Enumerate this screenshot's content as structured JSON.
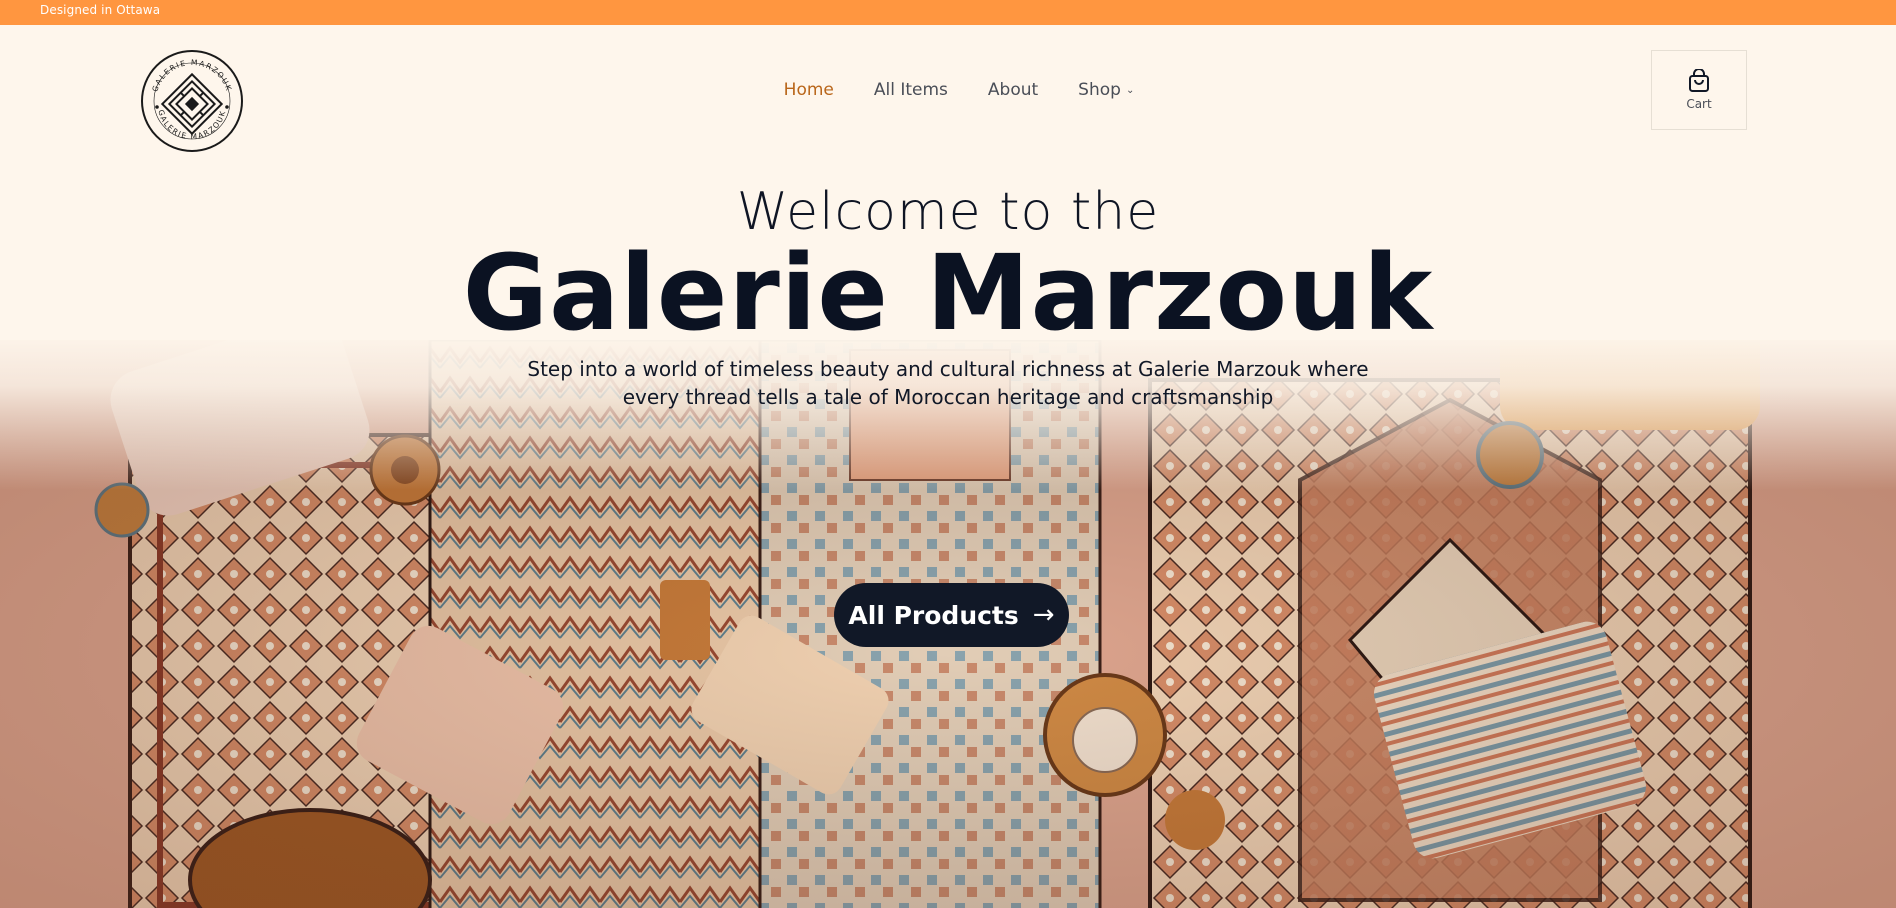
{
  "topbar": {
    "text": "Designed in Ottawa"
  },
  "logo": {
    "alt": "GALERIE MARZOUK",
    "ring_text": "GALERIE MARZOUK"
  },
  "nav": {
    "items": [
      {
        "label": "Home",
        "active": true
      },
      {
        "label": "All Items",
        "active": false
      },
      {
        "label": "About",
        "active": false
      },
      {
        "label": "Shop",
        "active": false,
        "dropdown": true
      }
    ]
  },
  "cart": {
    "label": "Cart",
    "icon": "shopping-bag-icon"
  },
  "hero": {
    "welcome": "Welcome to the",
    "title": "Galerie Marzouk",
    "tagline_line1": "Step into a world of timeless beauty and cultural richness at Galerie Marzouk where",
    "tagline_line2": "every thread tells a tale of Moroccan heritage and craftsmanship",
    "cta_label": "All Products",
    "cta_icon": "arrow-right-icon"
  },
  "colors": {
    "topbar": "#ff9640",
    "background": "#fef6ec",
    "active_nav": "#b9661a",
    "dark": "#111827"
  }
}
